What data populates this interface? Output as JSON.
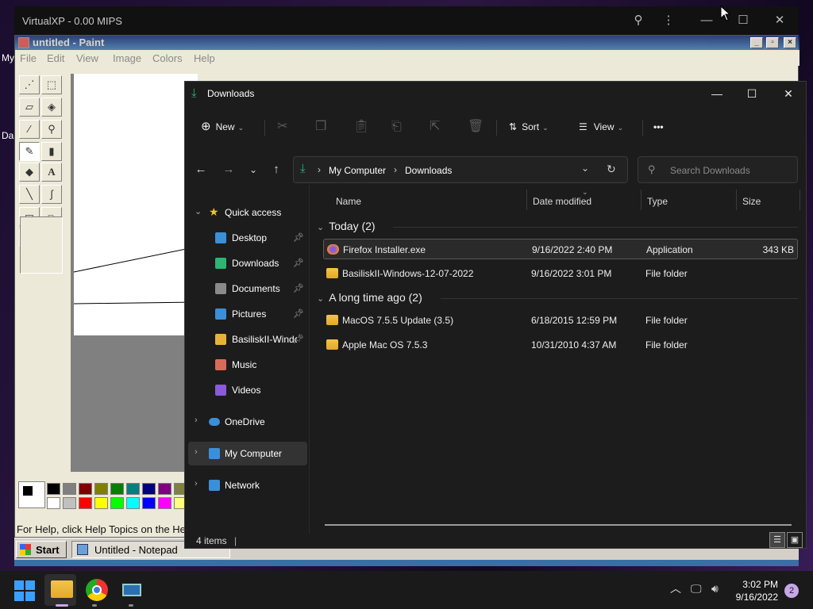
{
  "vxp": {
    "title": "VirtualXP - 0.00 MIPS",
    "search_icon": "⚲",
    "more_icon": "⋮",
    "min": "—",
    "max": "☐",
    "close": "✕"
  },
  "desktop_fragments": [
    "My",
    "Da"
  ],
  "paint": {
    "title": "untitled - Paint",
    "menu": [
      "File",
      "Edit",
      "View",
      "Image",
      "Colors",
      "Help"
    ],
    "status": "For Help, click Help Topics on the He",
    "palette_top": [
      "#000000",
      "#808080",
      "#800000",
      "#808000",
      "#008000",
      "#008080",
      "#000080",
      "#800080",
      "#808040"
    ],
    "palette_bottom": [
      "#ffffff",
      "#c0c0c0",
      "#ff0000",
      "#ffff00",
      "#00ff00",
      "#00ffff",
      "#0000ff",
      "#ff00ff",
      "#ffff80"
    ]
  },
  "xp_taskbar": {
    "start": "Start",
    "task1": "Untitled - Notepad"
  },
  "explorer": {
    "title": "Downloads",
    "toolbar": {
      "new": "New",
      "sort": "Sort",
      "view": "View",
      "more": "•••"
    },
    "address": {
      "root": "My Computer",
      "current": "Downloads"
    },
    "search_placeholder": "Search Downloads",
    "nav": {
      "quick_access": "Quick access",
      "items": [
        {
          "label": "Desktop",
          "pinned": true,
          "icon": "desktop-icon",
          "color": "#3b8fd9"
        },
        {
          "label": "Downloads",
          "pinned": true,
          "icon": "download-icon",
          "color": "#2bb673"
        },
        {
          "label": "Documents",
          "pinned": true,
          "icon": "document-icon",
          "color": "#8a8a8a"
        },
        {
          "label": "Pictures",
          "pinned": true,
          "icon": "picture-icon",
          "color": "#3b8fd9"
        },
        {
          "label": "BasiliskII-Windc",
          "pinned": true,
          "icon": "folder-icon",
          "color": "#e8b23a"
        },
        {
          "label": "Music",
          "pinned": false,
          "icon": "music-icon",
          "color": "#d96a5a"
        },
        {
          "label": "Videos",
          "pinned": false,
          "icon": "video-icon",
          "color": "#8a5ad9"
        }
      ],
      "onedrive": "OneDrive",
      "my_computer": "My Computer",
      "network": "Network"
    },
    "columns": {
      "name": "Name",
      "date": "Date modified",
      "type": "Type",
      "size": "Size"
    },
    "groups": [
      {
        "label": "Today (2)",
        "rows": [
          {
            "name": "Firefox Installer.exe",
            "date": "9/16/2022 2:40 PM",
            "type": "Application",
            "size": "343 KB",
            "icon": "firefox-icon"
          },
          {
            "name": "BasiliskII-Windows-12-07-2022",
            "date": "9/16/2022 3:01 PM",
            "type": "File folder",
            "size": "",
            "icon": "folder-icon"
          }
        ]
      },
      {
        "label": "A long time ago (2)",
        "rows": [
          {
            "name": "MacOS 7.5.5 Update (3.5)",
            "date": "6/18/2015 12:59 PM",
            "type": "File folder",
            "size": "",
            "icon": "folder-icon"
          },
          {
            "name": "Apple Mac OS 7.5.3",
            "date": "10/31/2010 4:37 AM",
            "type": "File folder",
            "size": "",
            "icon": "folder-icon"
          }
        ]
      }
    ],
    "status": "4 items"
  },
  "taskbar": {
    "time": "3:02 PM",
    "date": "9/16/2022",
    "notifications": "2"
  }
}
